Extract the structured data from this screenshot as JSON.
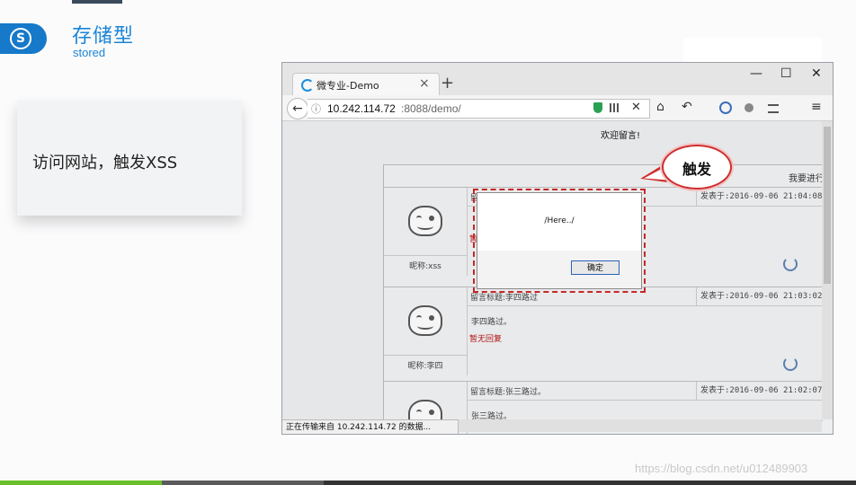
{
  "slide": {
    "title_cn": "存储型",
    "title_en": "stored",
    "logo_glyph": "S",
    "card_text": "访问网站，触发XSS",
    "callout_text": "触发",
    "watermark": "https://blog.csdn.net/u012489903",
    "accent": "#1b84d6"
  },
  "browser": {
    "tab_title": "微专业-Demo",
    "tab_close": "×",
    "new_tab": "+",
    "win_min": "—",
    "win_max": "☐",
    "win_close": "✕",
    "back": "←",
    "info": "ⓘ",
    "url_host": "10.242.114.72",
    "url_path": ":8088/demo/",
    "url_clear": "✕",
    "toolbar": {
      "home": "⌂",
      "undo": "↶",
      "menu": "≡"
    },
    "status": "正在传输来自 10.242.114.72 的数据..."
  },
  "page": {
    "welcome": "欢迎留言!",
    "board_header": "我要进行",
    "posts": [
      {
        "nick": "昵称:xss",
        "title": "留",
        "time": "发表于:2016-09-06 21:04:08",
        "body": "",
        "reply": "暂"
      },
      {
        "nick": "昵称:李四",
        "title": "留言标题:李四路过",
        "time": "发表于:2016-09-06 21:03:02",
        "body": "李四路过。",
        "reply": "暂无回复"
      },
      {
        "nick": "",
        "title": "留言标题:张三路过。",
        "time": "发表于:2016-09-06 21:02:07",
        "body": "张三路过。",
        "reply": ""
      }
    ]
  },
  "dialog": {
    "message": "/Here../",
    "ok": "确定"
  }
}
